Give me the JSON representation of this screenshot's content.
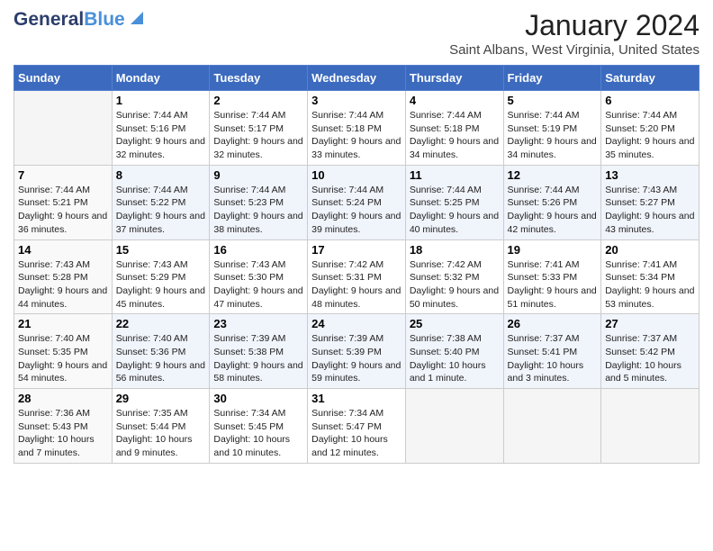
{
  "logo": {
    "general": "General",
    "blue": "Blue"
  },
  "title": "January 2024",
  "subtitle": "Saint Albans, West Virginia, United States",
  "weekdays": [
    "Sunday",
    "Monday",
    "Tuesday",
    "Wednesday",
    "Thursday",
    "Friday",
    "Saturday"
  ],
  "weeks": [
    [
      {
        "day": "",
        "sunrise": "",
        "sunset": "",
        "daylight": ""
      },
      {
        "day": "1",
        "sunrise": "Sunrise: 7:44 AM",
        "sunset": "Sunset: 5:16 PM",
        "daylight": "Daylight: 9 hours and 32 minutes."
      },
      {
        "day": "2",
        "sunrise": "Sunrise: 7:44 AM",
        "sunset": "Sunset: 5:17 PM",
        "daylight": "Daylight: 9 hours and 32 minutes."
      },
      {
        "day": "3",
        "sunrise": "Sunrise: 7:44 AM",
        "sunset": "Sunset: 5:18 PM",
        "daylight": "Daylight: 9 hours and 33 minutes."
      },
      {
        "day": "4",
        "sunrise": "Sunrise: 7:44 AM",
        "sunset": "Sunset: 5:18 PM",
        "daylight": "Daylight: 9 hours and 34 minutes."
      },
      {
        "day": "5",
        "sunrise": "Sunrise: 7:44 AM",
        "sunset": "Sunset: 5:19 PM",
        "daylight": "Daylight: 9 hours and 34 minutes."
      },
      {
        "day": "6",
        "sunrise": "Sunrise: 7:44 AM",
        "sunset": "Sunset: 5:20 PM",
        "daylight": "Daylight: 9 hours and 35 minutes."
      }
    ],
    [
      {
        "day": "7",
        "sunrise": "Sunrise: 7:44 AM",
        "sunset": "Sunset: 5:21 PM",
        "daylight": "Daylight: 9 hours and 36 minutes."
      },
      {
        "day": "8",
        "sunrise": "Sunrise: 7:44 AM",
        "sunset": "Sunset: 5:22 PM",
        "daylight": "Daylight: 9 hours and 37 minutes."
      },
      {
        "day": "9",
        "sunrise": "Sunrise: 7:44 AM",
        "sunset": "Sunset: 5:23 PM",
        "daylight": "Daylight: 9 hours and 38 minutes."
      },
      {
        "day": "10",
        "sunrise": "Sunrise: 7:44 AM",
        "sunset": "Sunset: 5:24 PM",
        "daylight": "Daylight: 9 hours and 39 minutes."
      },
      {
        "day": "11",
        "sunrise": "Sunrise: 7:44 AM",
        "sunset": "Sunset: 5:25 PM",
        "daylight": "Daylight: 9 hours and 40 minutes."
      },
      {
        "day": "12",
        "sunrise": "Sunrise: 7:44 AM",
        "sunset": "Sunset: 5:26 PM",
        "daylight": "Daylight: 9 hours and 42 minutes."
      },
      {
        "day": "13",
        "sunrise": "Sunrise: 7:43 AM",
        "sunset": "Sunset: 5:27 PM",
        "daylight": "Daylight: 9 hours and 43 minutes."
      }
    ],
    [
      {
        "day": "14",
        "sunrise": "Sunrise: 7:43 AM",
        "sunset": "Sunset: 5:28 PM",
        "daylight": "Daylight: 9 hours and 44 minutes."
      },
      {
        "day": "15",
        "sunrise": "Sunrise: 7:43 AM",
        "sunset": "Sunset: 5:29 PM",
        "daylight": "Daylight: 9 hours and 45 minutes."
      },
      {
        "day": "16",
        "sunrise": "Sunrise: 7:43 AM",
        "sunset": "Sunset: 5:30 PM",
        "daylight": "Daylight: 9 hours and 47 minutes."
      },
      {
        "day": "17",
        "sunrise": "Sunrise: 7:42 AM",
        "sunset": "Sunset: 5:31 PM",
        "daylight": "Daylight: 9 hours and 48 minutes."
      },
      {
        "day": "18",
        "sunrise": "Sunrise: 7:42 AM",
        "sunset": "Sunset: 5:32 PM",
        "daylight": "Daylight: 9 hours and 50 minutes."
      },
      {
        "day": "19",
        "sunrise": "Sunrise: 7:41 AM",
        "sunset": "Sunset: 5:33 PM",
        "daylight": "Daylight: 9 hours and 51 minutes."
      },
      {
        "day": "20",
        "sunrise": "Sunrise: 7:41 AM",
        "sunset": "Sunset: 5:34 PM",
        "daylight": "Daylight: 9 hours and 53 minutes."
      }
    ],
    [
      {
        "day": "21",
        "sunrise": "Sunrise: 7:40 AM",
        "sunset": "Sunset: 5:35 PM",
        "daylight": "Daylight: 9 hours and 54 minutes."
      },
      {
        "day": "22",
        "sunrise": "Sunrise: 7:40 AM",
        "sunset": "Sunset: 5:36 PM",
        "daylight": "Daylight: 9 hours and 56 minutes."
      },
      {
        "day": "23",
        "sunrise": "Sunrise: 7:39 AM",
        "sunset": "Sunset: 5:38 PM",
        "daylight": "Daylight: 9 hours and 58 minutes."
      },
      {
        "day": "24",
        "sunrise": "Sunrise: 7:39 AM",
        "sunset": "Sunset: 5:39 PM",
        "daylight": "Daylight: 9 hours and 59 minutes."
      },
      {
        "day": "25",
        "sunrise": "Sunrise: 7:38 AM",
        "sunset": "Sunset: 5:40 PM",
        "daylight": "Daylight: 10 hours and 1 minute."
      },
      {
        "day": "26",
        "sunrise": "Sunrise: 7:37 AM",
        "sunset": "Sunset: 5:41 PM",
        "daylight": "Daylight: 10 hours and 3 minutes."
      },
      {
        "day": "27",
        "sunrise": "Sunrise: 7:37 AM",
        "sunset": "Sunset: 5:42 PM",
        "daylight": "Daylight: 10 hours and 5 minutes."
      }
    ],
    [
      {
        "day": "28",
        "sunrise": "Sunrise: 7:36 AM",
        "sunset": "Sunset: 5:43 PM",
        "daylight": "Daylight: 10 hours and 7 minutes."
      },
      {
        "day": "29",
        "sunrise": "Sunrise: 7:35 AM",
        "sunset": "Sunset: 5:44 PM",
        "daylight": "Daylight: 10 hours and 9 minutes."
      },
      {
        "day": "30",
        "sunrise": "Sunrise: 7:34 AM",
        "sunset": "Sunset: 5:45 PM",
        "daylight": "Daylight: 10 hours and 10 minutes."
      },
      {
        "day": "31",
        "sunrise": "Sunrise: 7:34 AM",
        "sunset": "Sunset: 5:47 PM",
        "daylight": "Daylight: 10 hours and 12 minutes."
      },
      {
        "day": "",
        "sunrise": "",
        "sunset": "",
        "daylight": ""
      },
      {
        "day": "",
        "sunrise": "",
        "sunset": "",
        "daylight": ""
      },
      {
        "day": "",
        "sunrise": "",
        "sunset": "",
        "daylight": ""
      }
    ]
  ]
}
